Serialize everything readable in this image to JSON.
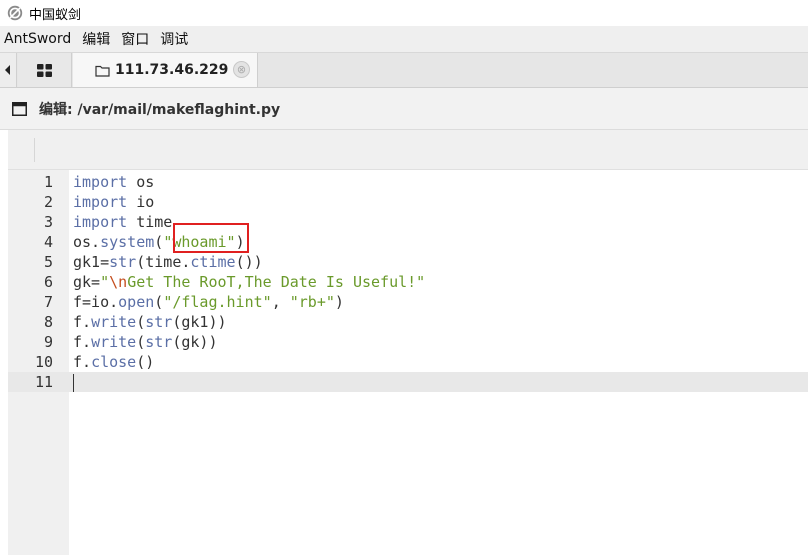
{
  "window": {
    "title": "中国蚁剑",
    "icon": "antsword-logo-icon"
  },
  "menubar": {
    "items": [
      "AntSword",
      "编辑",
      "窗口",
      "调试"
    ]
  },
  "tabs": {
    "grid_icon": "grid-icon",
    "shell_tab_label": "111.73.46.229",
    "close_glyph": "⊗"
  },
  "panel": {
    "title": "编辑: /var/mail/makeflaghint.py"
  },
  "editor": {
    "lines": [
      {
        "num": "1",
        "tokens": [
          [
            "kw",
            "import"
          ],
          [
            "plain",
            " os"
          ]
        ]
      },
      {
        "num": "2",
        "tokens": [
          [
            "kw",
            "import"
          ],
          [
            "plain",
            " io"
          ]
        ]
      },
      {
        "num": "3",
        "tokens": [
          [
            "kw",
            "import"
          ],
          [
            "plain",
            " time"
          ]
        ]
      },
      {
        "num": "4",
        "tokens": [
          [
            "plain",
            "os."
          ],
          [
            "fn",
            "system"
          ],
          [
            "plain",
            "("
          ],
          [
            "str",
            "\"whoami\""
          ],
          [
            "plain",
            ")"
          ]
        ]
      },
      {
        "num": "5",
        "tokens": [
          [
            "plain",
            "gk1="
          ],
          [
            "fn",
            "str"
          ],
          [
            "plain",
            "(time."
          ],
          [
            "fn",
            "ctime"
          ],
          [
            "plain",
            "())"
          ]
        ]
      },
      {
        "num": "6",
        "tokens": [
          [
            "plain",
            "gk="
          ],
          [
            "str",
            "\""
          ],
          [
            "esc",
            "\\n"
          ],
          [
            "str",
            "Get The RooT,The Date Is Useful!\""
          ]
        ]
      },
      {
        "num": "7",
        "tokens": [
          [
            "plain",
            "f=io."
          ],
          [
            "fn",
            "open"
          ],
          [
            "plain",
            "("
          ],
          [
            "str",
            "\"/flag.hint\""
          ],
          [
            "plain",
            ", "
          ],
          [
            "str",
            "\"rb+\""
          ],
          [
            "plain",
            ")"
          ]
        ]
      },
      {
        "num": "8",
        "tokens": [
          [
            "plain",
            "f."
          ],
          [
            "fn",
            "write"
          ],
          [
            "plain",
            "("
          ],
          [
            "fn",
            "str"
          ],
          [
            "plain",
            "(gk1))"
          ]
        ]
      },
      {
        "num": "9",
        "tokens": [
          [
            "plain",
            "f."
          ],
          [
            "fn",
            "write"
          ],
          [
            "plain",
            "("
          ],
          [
            "fn",
            "str"
          ],
          [
            "plain",
            "(gk))"
          ]
        ]
      },
      {
        "num": "10",
        "tokens": [
          [
            "plain",
            "f."
          ],
          [
            "fn",
            "close"
          ],
          [
            "plain",
            "()"
          ]
        ]
      },
      {
        "num": "11",
        "tokens": []
      }
    ],
    "active_line": "11"
  },
  "colors": {
    "keyword": "#5b6fa6",
    "string": "#6a9a2b",
    "escape": "#c44d1d",
    "annotation_box": "#e02020"
  }
}
